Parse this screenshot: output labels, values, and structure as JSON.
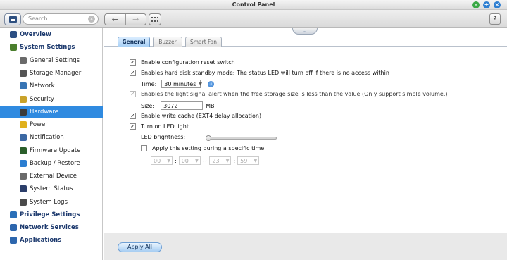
{
  "window": {
    "title": "Control Panel",
    "minimize_symbol": "-",
    "maximize_symbol": "+",
    "close_symbol": "×"
  },
  "toolbar": {
    "search_placeholder": "Search",
    "search_clear_symbol": "×",
    "back_symbol": "←",
    "forward_symbol": "→",
    "help_label": "?"
  },
  "sidebar": {
    "items": [
      {
        "label": "Overview",
        "level": "top",
        "icon": "overview-icon"
      },
      {
        "label": "System Settings",
        "level": "top",
        "icon": "gear-icon"
      },
      {
        "label": "General Settings",
        "level": "sub",
        "icon": "general-settings-icon"
      },
      {
        "label": "Storage Manager",
        "level": "sub",
        "icon": "storage-icon"
      },
      {
        "label": "Network",
        "level": "sub",
        "icon": "network-icon"
      },
      {
        "label": "Security",
        "level": "sub",
        "icon": "lock-icon"
      },
      {
        "label": "Hardware",
        "level": "sub",
        "icon": "hardware-icon",
        "selected": true
      },
      {
        "label": "Power",
        "level": "sub",
        "icon": "power-icon"
      },
      {
        "label": "Notification",
        "level": "sub",
        "icon": "notification-icon"
      },
      {
        "label": "Firmware Update",
        "level": "sub",
        "icon": "firmware-icon"
      },
      {
        "label": "Backup / Restore",
        "level": "sub",
        "icon": "backup-icon"
      },
      {
        "label": "External Device",
        "level": "sub",
        "icon": "external-device-icon"
      },
      {
        "label": "System Status",
        "level": "sub",
        "icon": "status-icon"
      },
      {
        "label": "System Logs",
        "level": "sub",
        "icon": "logs-icon"
      },
      {
        "label": "Privilege Settings",
        "level": "top",
        "icon": "users-icon"
      },
      {
        "label": "Network Services",
        "level": "top",
        "icon": "globe-icon"
      },
      {
        "label": "Applications",
        "level": "top",
        "icon": "applications-icon"
      }
    ]
  },
  "tabs": [
    "General",
    "Buzzer",
    "Smart Fan"
  ],
  "collapse_symbol": "⌄",
  "settings": {
    "reset_switch": {
      "label": "Enable configuration reset switch",
      "checked": true
    },
    "standby": {
      "label": "Enables hard disk standby mode: The status LED will turn off if there is no access within",
      "checked": true
    },
    "time_label": "Time:",
    "time_value": "30 minutes",
    "info_symbol": "i",
    "light_alert": {
      "label": "Enables the light signal alert when the free storage size is less than the value (Only support simple volume.)",
      "checked": true,
      "disabled": true
    },
    "size_label": "Size:",
    "size_value": "3072",
    "size_unit": "MB",
    "write_cache": {
      "label": "Enable write cache (EXT4 delay allocation)",
      "checked": true
    },
    "led_light": {
      "label": "Turn on LED light",
      "checked": true
    },
    "led_brightness_label": "LED brightness:",
    "led_brightness_level": 0,
    "schedule": {
      "label": "Apply this setting during a specific time",
      "checked": false
    },
    "time_range": {
      "start_hour": "00",
      "start_min": "00",
      "end_hour": "23",
      "end_min": "59",
      "colon": ":",
      "tilde": "~"
    }
  },
  "footer": {
    "apply_label": "Apply All"
  },
  "check_mark": "✓"
}
